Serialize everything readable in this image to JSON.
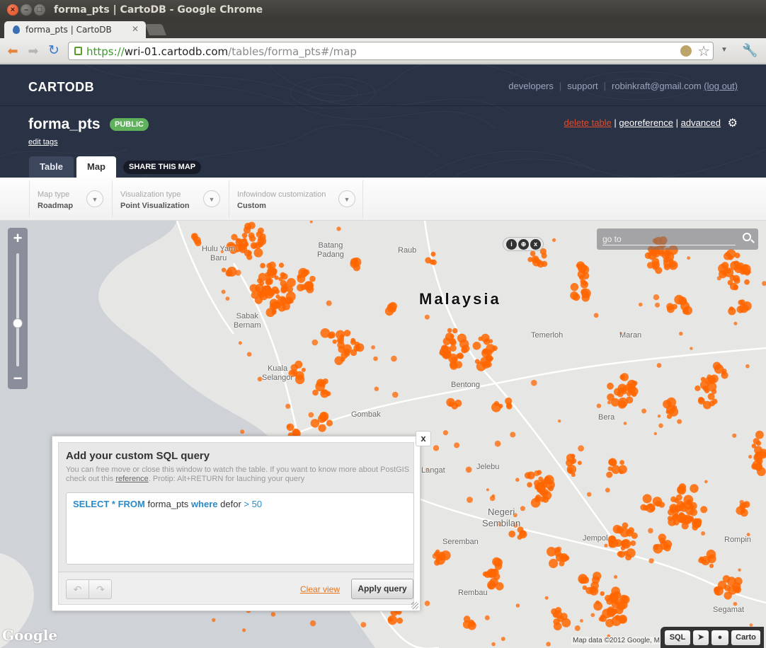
{
  "window": {
    "title": "forma_pts | CartoDB - Google Chrome"
  },
  "browser": {
    "tab_title": "forma_pts | CartoDB",
    "url": {
      "scheme": "https://",
      "host": "wri-01.cartodb.com",
      "path": "/tables/forma_pts#/map"
    }
  },
  "header": {
    "logo": "CARTODB",
    "nav": {
      "developers": "developers",
      "support": "support",
      "email": "robinkraft@gmail.com",
      "logout": "(log out)"
    },
    "table_name": "forma_pts",
    "privacy_badge": "PUBLIC",
    "edit_tags": "edit tags",
    "actions": {
      "delete": "delete table",
      "georeference": "georeference",
      "advanced": "advanced"
    },
    "tabs": {
      "table": "Table",
      "map": "Map"
    },
    "share": "SHARE THIS MAP"
  },
  "options": [
    {
      "label": "Map type",
      "value": "Roadmap"
    },
    {
      "label": "Visualization type",
      "value": "Point Visualization"
    },
    {
      "label": "Infowindow customization",
      "value": "Custom"
    }
  ],
  "map": {
    "goto_placeholder": "go to",
    "country_label": "Malaysia",
    "places": {
      "ulu": "Hulu Yam\nBaru",
      "batang": "Batang\nPadang",
      "raub": "Raub",
      "sabak": "Sabak\nBernam",
      "temerloh": "Temerloh",
      "maran": "Maran",
      "kuala": "Kuala\nSelangor",
      "bentong": "Bentong",
      "gombak": "Gombak",
      "bera": "Bera",
      "langat": "Langat",
      "jelebu": "Jelebu",
      "negeri": "Negeri\nSembilan",
      "seremban": "Seremban",
      "jempol": "Jempol",
      "rompin": "Rompin",
      "rembau": "Rembau",
      "segamat": "Segamat"
    },
    "attribution": "Map data ©2012 Google, M",
    "google": "Google",
    "point_color": "#ff6600"
  },
  "toolbox": {
    "sql": "SQL",
    "carto": "Carto"
  },
  "sql_dialog": {
    "title": "Add your custom SQL query",
    "desc_1": "You can free move or close this window to watch the table. If you want to know more about PostGIS check out this",
    "desc_link": "reference",
    "desc_2": ". Protip: Alt+RETURN for lauching your query",
    "query": {
      "select": "SELECT",
      "star_from": "* FROM",
      "table": "forma_pts",
      "where": "where",
      "field": "defor",
      "condition": "> 50"
    },
    "clear_view": "Clear view",
    "apply": "Apply query",
    "close": "x"
  }
}
